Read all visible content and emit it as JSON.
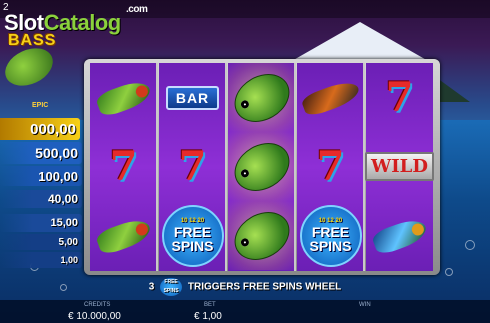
{
  "window": {
    "corner_number": "2"
  },
  "watermark": {
    "slot": "Slot",
    "catalog": "Catalog",
    "com": ".com"
  },
  "game_logo": {
    "title": "BASS",
    "subtitle": "EPIC"
  },
  "paytable": [
    {
      "value": "000,00",
      "color": "#f7d117"
    },
    {
      "value": "500,00",
      "color": "#1f5fbf"
    },
    {
      "value": "100,00",
      "color": "#1a55b0"
    },
    {
      "value": "40,00",
      "color": "#1a4a9a"
    },
    {
      "value": "15,00",
      "color": "#1a4a9a"
    },
    {
      "value": "5,00",
      "color": "#143e86"
    },
    {
      "value": "1,00",
      "color": "#143e86"
    }
  ],
  "reels": [
    [
      "fly-green",
      "seven",
      "fly-green"
    ],
    [
      "bar",
      "seven",
      "free-spins"
    ],
    [
      "bass-fish",
      "bass-fish",
      "bass-fish"
    ],
    [
      "fly-orange",
      "seven",
      "free-spins"
    ],
    [
      "seven",
      "wild",
      "fly-blue"
    ]
  ],
  "winning_cells": [
    [
      2,
      0
    ],
    [
      2,
      1
    ],
    [
      2,
      2
    ]
  ],
  "symbol_text": {
    "bar": "BAR",
    "wild": "WILD",
    "free": "FREE",
    "spins": "SPINS",
    "wheel_numbers": "10 12 20"
  },
  "trigger": {
    "count": "3",
    "badge_free": "FREE",
    "badge_spins": "SPINS",
    "text": "TRIGGERS FREE SPINS WHEEL"
  },
  "footer": {
    "credits_label": "CREDITS",
    "credits_value": "€ 10.000,00",
    "bet_label": "BET",
    "bet_value": "€ 1,00",
    "win_label": "WIN"
  }
}
